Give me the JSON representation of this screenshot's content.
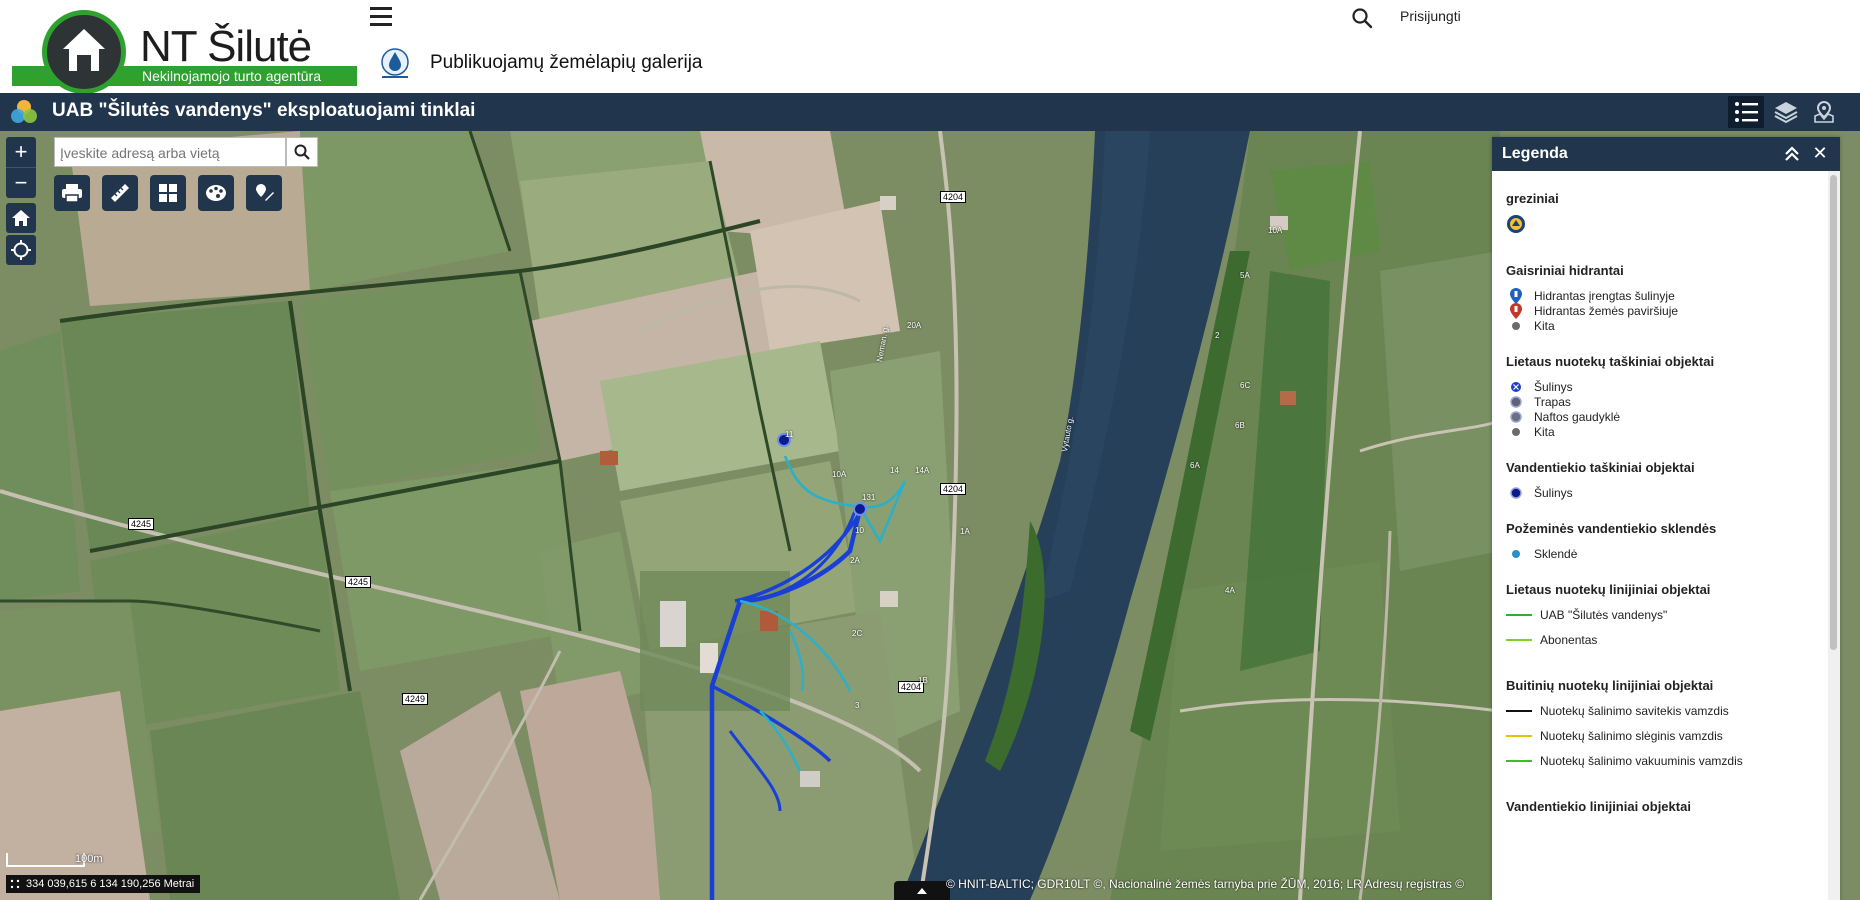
{
  "header": {
    "logo_title": "NT Šilutė",
    "logo_subtitle": "Nekilnojamojo turto agentūra",
    "gallery_title": "Publikuojamų žemėlapių galerija",
    "login": "Prisijungti"
  },
  "app": {
    "title": "UAB \"Šilutės vandenys\" eksploatuojami tinklai"
  },
  "map": {
    "search_placeholder": "Įveskite adresą arba vietą",
    "scale_label": "100m",
    "coordinates": "334 039,615 6 134 190,256 Metrai",
    "attribution": "© HNIT-BALTIC; GDR10LT ©, Nacionalinė žemės tarnyba prie ŽŪM, 2016; LR Adresų registras ©",
    "zoom_in": "+",
    "zoom_out": "−",
    "labels": [
      "4204",
      "4204",
      "4204",
      "4245",
      "4245",
      "4249",
      "20A",
      "10A",
      "14",
      "14A",
      "131",
      "11",
      "10",
      "2A",
      "2C",
      "3",
      "1B",
      "1A",
      "6A",
      "6B",
      "6C",
      "4A",
      "5A",
      "10A",
      "2",
      "Neman. g.",
      "Vytauto g."
    ],
    "colors": {
      "water": "#27405a",
      "network": "#1a3fd6",
      "network_alt": "#2ab0c8"
    }
  },
  "legend": {
    "title": "Legenda",
    "groups": [
      {
        "title": "greziniai",
        "items": [
          {
            "label": "",
            "symbol": "well-marker"
          }
        ]
      },
      {
        "title": "Gaisriniai hidrantai",
        "items": [
          {
            "label": "Hidrantas įrengtas šulinyje",
            "symbol": "hydrant-blue",
            "color": "#1f5fbf"
          },
          {
            "label": "Hidrantas žemės paviršiuje",
            "symbol": "hydrant-red",
            "color": "#c0392b"
          },
          {
            "label": "Kita",
            "symbol": "dot",
            "color": "#6b6b6b"
          }
        ]
      },
      {
        "title": "Lietaus nuotekų taškiniai objektai",
        "items": [
          {
            "label": "Šulinys",
            "symbol": "dot-x",
            "color": "#1b3ed1"
          },
          {
            "label": "Trapas",
            "symbol": "dot-ring",
            "color": "#5f6377"
          },
          {
            "label": "Naftos gaudyklė",
            "symbol": "dot-ring",
            "color": "#6c6e80"
          },
          {
            "label": "Kita",
            "symbol": "dot",
            "color": "#6b6b6b"
          }
        ]
      },
      {
        "title": "Vandentiekio taškiniai objektai",
        "items": [
          {
            "label": "Šulinys",
            "symbol": "dot-ring",
            "color": "#0b1b8c"
          }
        ]
      },
      {
        "title": "Požeminės vandentiekio sklendės",
        "items": [
          {
            "label": "Sklendė",
            "symbol": "dot",
            "color": "#2a8fc7"
          }
        ]
      },
      {
        "title": "Lietaus nuotekų linijiniai objektai",
        "items": [
          {
            "label": "UAB \"Šilutės vandenys\"",
            "symbol": "line",
            "color": "#2fae35"
          },
          {
            "label": "Abonentas",
            "symbol": "line",
            "color": "#7ed321"
          }
        ]
      },
      {
        "title": "Buitinių nuotekų linijiniai objektai",
        "items": [
          {
            "label": "Nuotekų šalinimo savitekis vamzdis",
            "symbol": "line",
            "color": "#111111"
          },
          {
            "label": "Nuotekų šalinimo slėginis vamzdis",
            "symbol": "line",
            "color": "#e2c10b"
          },
          {
            "label": "Nuotekų šalinimo vakuuminis vamzdis",
            "symbol": "line",
            "color": "#3cc021"
          }
        ]
      },
      {
        "title": "Vandentiekio linijiniai objektai",
        "items": []
      }
    ]
  }
}
